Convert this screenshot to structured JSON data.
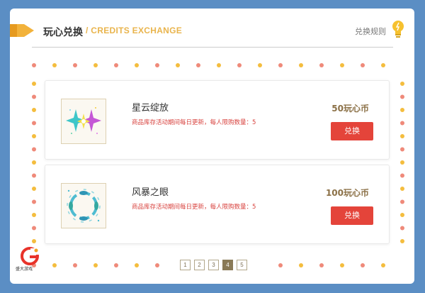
{
  "header": {
    "title_cn": "玩心兑换",
    "title_en": "/ CREDITS EXCHANGE",
    "rules_link": "兑换规则"
  },
  "items": [
    {
      "name": "星云绽放",
      "note": "商品库存活动期间每日更新，每人限购数量：5",
      "price": "50玩心币",
      "button": "兑换",
      "image_icon": "nebula-sparkle-icon"
    },
    {
      "name": "风暴之眼",
      "note": "商品库存活动期间每日更新，每人限购数量：5",
      "price": "100玩心币",
      "button": "兑换",
      "image_icon": "storm-eye-ring-icon"
    }
  ],
  "pagination": {
    "pages": [
      "1",
      "2",
      "3",
      "4",
      "5"
    ],
    "current": "4"
  },
  "brand": {
    "logo_text": "盛大游戏"
  },
  "colors": {
    "background": "#5b8ec4",
    "accent_gold": "#e9b44c",
    "button_red": "#e4443a",
    "dot_pink": "#ef8a7a",
    "dot_yellow": "#f4bd3e"
  }
}
